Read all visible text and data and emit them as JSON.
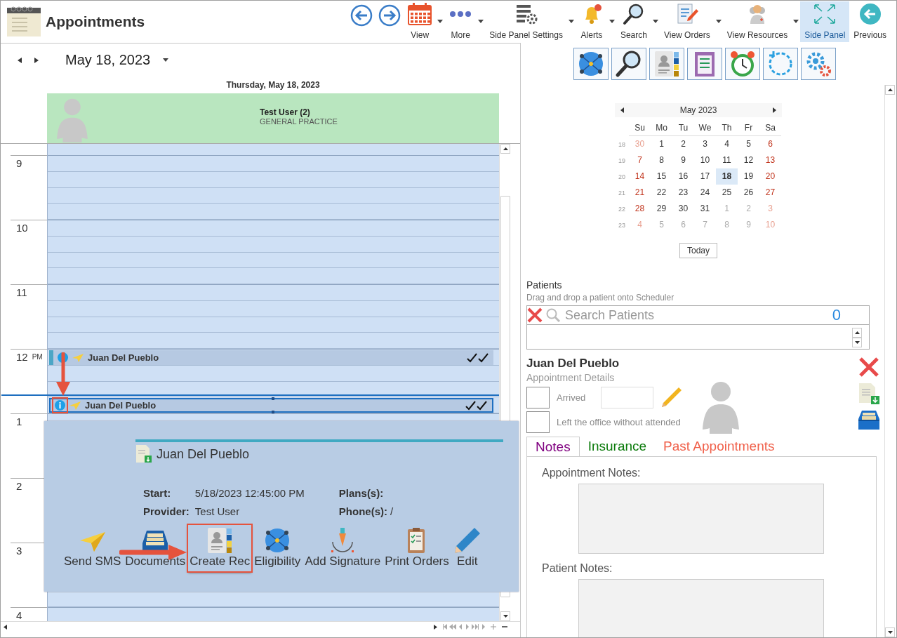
{
  "window": {
    "title": "Appointments"
  },
  "toolbar": {
    "buttons": [
      {
        "label": "View",
        "dropdown": true,
        "selected": false
      },
      {
        "label": "More",
        "dropdown": true,
        "selected": false
      },
      {
        "label": "Side Panel Settings",
        "dropdown": true,
        "selected": false
      },
      {
        "label": "Alerts",
        "dropdown": true,
        "selected": false
      },
      {
        "label": "Search",
        "dropdown": true,
        "selected": false
      },
      {
        "label": "View Orders",
        "dropdown": true,
        "selected": false
      },
      {
        "label": "View Resources",
        "dropdown": true,
        "selected": false
      },
      {
        "label": "Side Panel",
        "dropdown": false,
        "selected": true
      },
      {
        "label": "Previous",
        "dropdown": false,
        "selected": false
      }
    ]
  },
  "scheduler": {
    "date": "May 18, 2023",
    "day_header": "Thursday, May 18, 2023",
    "resource": {
      "name": "Test User (2)",
      "specialty": "GENERAL PRACTICE"
    },
    "hours": [
      {
        "label": "9"
      },
      {
        "label": "10"
      },
      {
        "label": "11"
      },
      {
        "label": "12",
        "suffix": "PM",
        "slots": [
          {
            "now": false,
            "appointment": {
              "patient": "Juan Del Pueblo",
              "selected": false,
              "highlighted": false
            }
          },
          {
            "now": false
          },
          {
            "now": false
          },
          {
            "now": true,
            "appointment": {
              "patient": "Juan Del Pueblo",
              "selected": true,
              "highlighted": true
            }
          }
        ]
      },
      {
        "label": "1"
      },
      {
        "label": "2"
      },
      {
        "label": "3"
      },
      {
        "label": "4"
      }
    ]
  },
  "popup": {
    "patient": "Juan Del Pueblo",
    "fields": [
      {
        "label": "Start:",
        "value": "5/18/2023 12:45:00 PM"
      },
      {
        "label": "Plans(s):"
      },
      {
        "label": "Provider:",
        "value": "Test User"
      },
      {
        "label": "Phone(s):",
        "value": "/"
      }
    ],
    "actions": [
      {
        "label": "Send SMS",
        "highlighted": false
      },
      {
        "label": "Documents",
        "highlighted": false
      },
      {
        "label": "Create Rec",
        "highlighted": true
      },
      {
        "label": "Eligibility",
        "highlighted": false
      },
      {
        "label": "Add Signature",
        "highlighted": false
      },
      {
        "label": "Print Orders",
        "highlighted": false
      },
      {
        "label": "Edit",
        "highlighted": false
      }
    ]
  },
  "side_panel": {
    "calendar": {
      "month": "May 2023",
      "weekdays": [
        "Su",
        "Mo",
        "Tu",
        "We",
        "Th",
        "Fr",
        "Sa"
      ],
      "weeks": [
        {
          "number": "18",
          "days": [
            {
              "day": "30",
              "other": true,
              "selected": false
            },
            {
              "day": "1",
              "other": false,
              "selected": false
            },
            {
              "day": "2",
              "other": false,
              "selected": false
            },
            {
              "day": "3",
              "other": false,
              "selected": false
            },
            {
              "day": "4",
              "other": false,
              "selected": false
            },
            {
              "day": "5",
              "other": false,
              "selected": false
            },
            {
              "day": "6",
              "other": false,
              "selected": false
            }
          ]
        },
        {
          "number": "19",
          "days": [
            {
              "day": "7",
              "other": false,
              "selected": false
            },
            {
              "day": "8",
              "other": false,
              "selected": false
            },
            {
              "day": "9",
              "other": false,
              "selected": false
            },
            {
              "day": "10",
              "other": false,
              "selected": false
            },
            {
              "day": "11",
              "other": false,
              "selected": false
            },
            {
              "day": "12",
              "other": false,
              "selected": false
            },
            {
              "day": "13",
              "other": false,
              "selected": false
            }
          ]
        },
        {
          "number": "20",
          "days": [
            {
              "day": "14",
              "other": false,
              "selected": false
            },
            {
              "day": "15",
              "other": false,
              "selected": false
            },
            {
              "day": "16",
              "other": false,
              "selected": false
            },
            {
              "day": "17",
              "other": false,
              "selected": false
            },
            {
              "day": "18",
              "other": false,
              "selected": true
            },
            {
              "day": "19",
              "other": false,
              "selected": false
            },
            {
              "day": "20",
              "other": false,
              "selected": false
            }
          ]
        },
        {
          "number": "21",
          "days": [
            {
              "day": "21",
              "other": false,
              "selected": false
            },
            {
              "day": "22",
              "other": false,
              "selected": false
            },
            {
              "day": "23",
              "other": false,
              "selected": false
            },
            {
              "day": "24",
              "other": false,
              "selected": false
            },
            {
              "day": "25",
              "other": false,
              "selected": false
            },
            {
              "day": "26",
              "other": false,
              "selected": false
            },
            {
              "day": "27",
              "other": false,
              "selected": false
            }
          ]
        },
        {
          "number": "22",
          "days": [
            {
              "day": "28",
              "other": false,
              "selected": false
            },
            {
              "day": "29",
              "other": false,
              "selected": false
            },
            {
              "day": "30",
              "other": false,
              "selected": false
            },
            {
              "day": "31",
              "other": false,
              "selected": false
            },
            {
              "day": "1",
              "other": true,
              "selected": false
            },
            {
              "day": "2",
              "other": true,
              "selected": false
            },
            {
              "day": "3",
              "other": true,
              "selected": false
            }
          ]
        },
        {
          "number": "23",
          "days": [
            {
              "day": "4",
              "other": true,
              "selected": false
            },
            {
              "day": "5",
              "other": true,
              "selected": false
            },
            {
              "day": "6",
              "other": true,
              "selected": false
            },
            {
              "day": "7",
              "other": true,
              "selected": false
            },
            {
              "day": "8",
              "other": true,
              "selected": false
            },
            {
              "day": "9",
              "other": true,
              "selected": false
            },
            {
              "day": "10",
              "other": true,
              "selected": false
            }
          ]
        }
      ],
      "today_button": "Today"
    },
    "patients": {
      "title": "Patients",
      "hint": "Drag and drop a patient onto Scheduler",
      "search": {
        "placeholder": "Search Patients"
      },
      "count": "0"
    },
    "details": {
      "patient": "Juan Del Pueblo",
      "subtitle": "Appointment Details",
      "arrived": {
        "label": "Arrived",
        "checked": false
      },
      "left_office": {
        "label": "Left the office without attended",
        "checked": false
      },
      "tabs": [
        {
          "label": "Notes",
          "color": "#800080",
          "selected": true
        },
        {
          "label": "Insurance",
          "color": "#0a7a0a",
          "selected": false
        },
        {
          "label": "Past Appointments",
          "color": "#f0604a",
          "selected": false
        }
      ],
      "sections": [
        {
          "label": "Appointment Notes:"
        },
        {
          "label": "Patient Notes:"
        }
      ]
    }
  }
}
